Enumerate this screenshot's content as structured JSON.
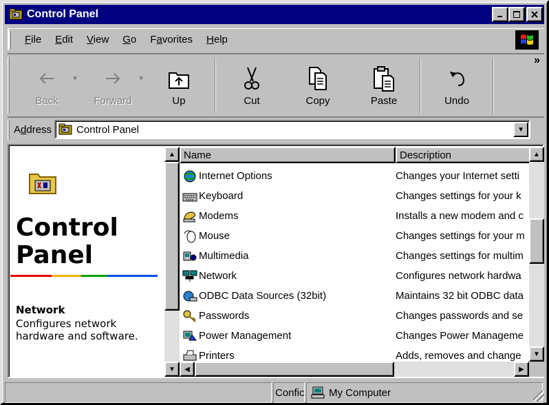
{
  "window": {
    "title": "Control Panel"
  },
  "menu": [
    {
      "label": "File",
      "u": "F",
      "rest": "ile"
    },
    {
      "label": "Edit",
      "u": "E",
      "rest": "dit"
    },
    {
      "label": "View",
      "u": "V",
      "rest": "iew"
    },
    {
      "label": "Go",
      "u": "G",
      "rest": "o"
    },
    {
      "label": "Favorites",
      "pre": "F",
      "u": "a",
      "rest": "vorites"
    },
    {
      "label": "Help",
      "u": "H",
      "rest": "elp"
    }
  ],
  "toolbar": {
    "back": "Back",
    "forward": "Forward",
    "up": "Up",
    "cut": "Cut",
    "copy": "Copy",
    "paste": "Paste",
    "undo": "Undo",
    "more": "»"
  },
  "address": {
    "label_pre": "A",
    "label_u": "d",
    "label_rest": "dress",
    "value": "Control Panel"
  },
  "left_pane": {
    "title_line1": "Control",
    "title_line2": "Panel",
    "selected_name": "Network",
    "selected_desc": "Configures network hardware and software."
  },
  "list": {
    "columns": [
      "Name",
      "Description"
    ],
    "rows": [
      {
        "name": "Internet Options",
        "desc": "Changes your Internet setti",
        "icon": "internet-options-icon"
      },
      {
        "name": "Keyboard",
        "desc": "Changes settings for your k",
        "icon": "keyboard-icon"
      },
      {
        "name": "Modems",
        "desc": "Installs a new modem and c",
        "icon": "modem-icon"
      },
      {
        "name": "Mouse",
        "desc": "Changes settings for your m",
        "icon": "mouse-icon"
      },
      {
        "name": "Multimedia",
        "desc": "Changes settings for multim",
        "icon": "multimedia-icon"
      },
      {
        "name": "Network",
        "desc": "Configures network hardwa",
        "icon": "network-icon"
      },
      {
        "name": "ODBC Data Sources (32bit)",
        "desc": "Maintains 32 bit ODBC data",
        "icon": "odbc-icon"
      },
      {
        "name": "Passwords",
        "desc": "Changes passwords and se",
        "icon": "passwords-icon"
      },
      {
        "name": "Power Management",
        "desc": "Changes Power Manageme",
        "icon": "power-management-icon"
      },
      {
        "name": "Printers",
        "desc": "Adds, removes and change",
        "icon": "printers-icon"
      }
    ]
  },
  "statusbar": {
    "left": "",
    "mid": "Confic",
    "zone": "My Computer"
  },
  "colors": {
    "titlebar": "#000080",
    "face": "#c0c0c0"
  }
}
